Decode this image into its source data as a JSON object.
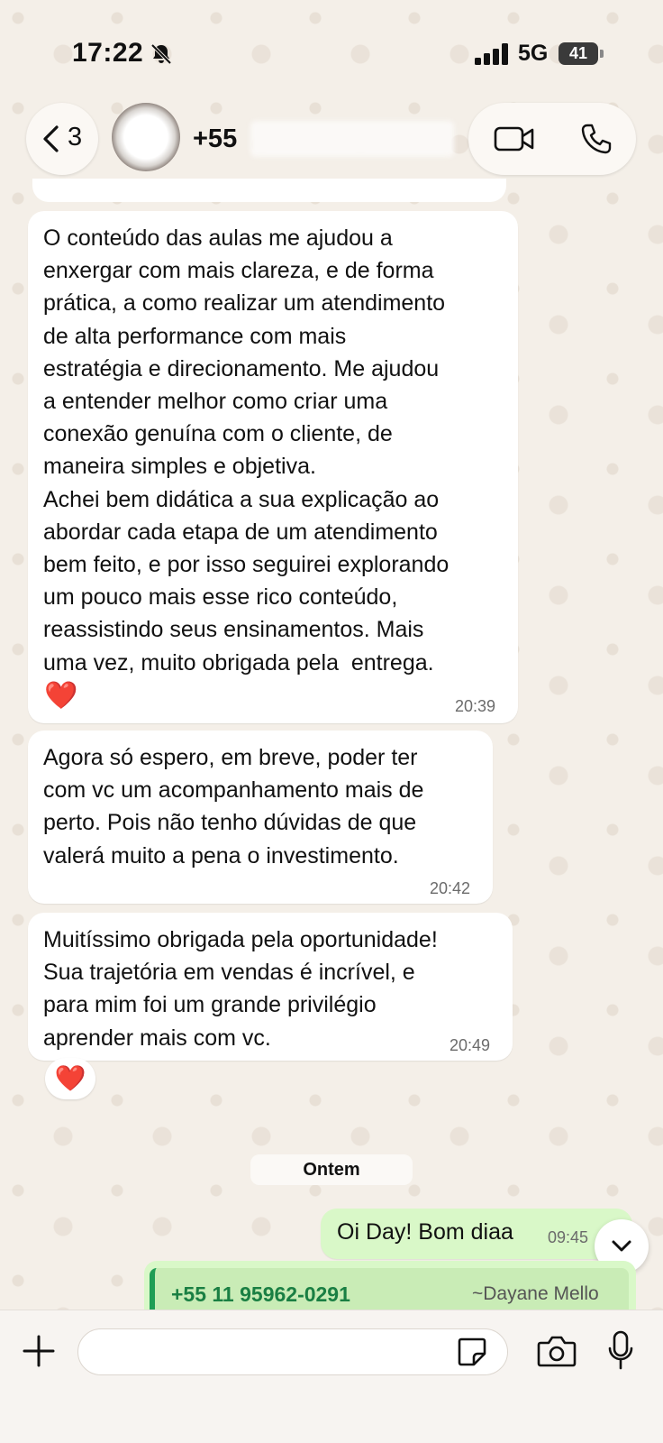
{
  "status_bar": {
    "time": "17:22",
    "network": "5G",
    "battery": "41"
  },
  "header": {
    "back_count": "3",
    "contact_name": "+55",
    "icons": [
      "chevron-left-icon",
      "video-call-icon",
      "phone-icon",
      "bell-off-icon"
    ]
  },
  "messages": [
    {
      "text": "O conteúdo das aulas me ajudou a\nenxergar com mais clareza, e de forma\nprática, a como realizar um atendimento\nde alta performance com mais\nestratégia e direcionamento. Me ajudou\na entender melhor como criar uma\nconexão genuína com o cliente, de\nmaneira simples e objetiva.\nAchei bem didática a sua explicação ao\nabordar cada etapa de um atendimento\nbem feito, e por isso seguirei explorando\num pouco mais esse rico conteúdo,\nreassistindo seus ensinamentos. Mais\numa vez, muito obrigada pela  entrega.",
      "emoji": "❤️",
      "time": "20:39"
    },
    {
      "text": "Agora só espero, em breve, poder ter\ncom vc um acompanhamento mais de\nperto. Pois não tenho dúvidas de que\nvalerá muito a pena o investimento.",
      "time": "20:42"
    },
    {
      "text": "Muitíssimo obrigada pela oportunidade!\nSua trajetória em vendas é incrível, e\npara mim foi um grande privilégio\naprender mais com vc.",
      "time": "20:49",
      "reaction": "❤️"
    }
  ],
  "date_separator": "Ontem",
  "outgoing": {
    "text": "Oi Day! Bom diaa",
    "time": "09:45"
  },
  "quoted_contact": {
    "phone": "+55 11 95962-0291",
    "name": "~Dayane Mello"
  },
  "composer": {
    "placeholder": ""
  },
  "colors": {
    "wallpaper": "#f4efe8",
    "incoming_bubble": "#ffffff",
    "outgoing_bubble": "#d9f8c8",
    "accent_green": "#1f9d55",
    "heart": "#e3262f"
  }
}
